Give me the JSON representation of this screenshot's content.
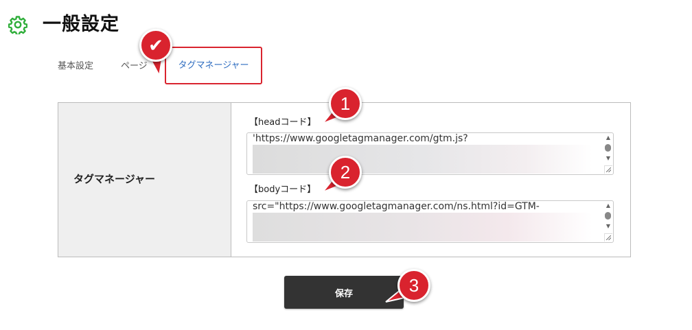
{
  "header": {
    "title": "一般設定",
    "icon": "gear-icon",
    "icon_color": "#2fae3a"
  },
  "tabs": [
    {
      "label": "基本設定",
      "active": false
    },
    {
      "label": "ページ",
      "active": false
    },
    {
      "label": "タグマネージャー",
      "active": true
    }
  ],
  "settings": {
    "row_label": "タグマネージャー",
    "head_code": {
      "label": "【headコード】",
      "value": "'https://www.googletagmanager.com/gtm.js?"
    },
    "body_code": {
      "label": "【bodyコード】",
      "value": "src=\"https://www.googletagmanager.com/ns.html?id=GTM-"
    }
  },
  "save_button": {
    "label": "保存"
  },
  "annotations": {
    "check": "✔",
    "step1": "1",
    "step2": "2",
    "step3": "3",
    "badge_color": "#d9232e"
  },
  "colors": {
    "accent_red": "#d9232e",
    "tab_active_text": "#2d6cc0",
    "button_bg": "#333333"
  }
}
